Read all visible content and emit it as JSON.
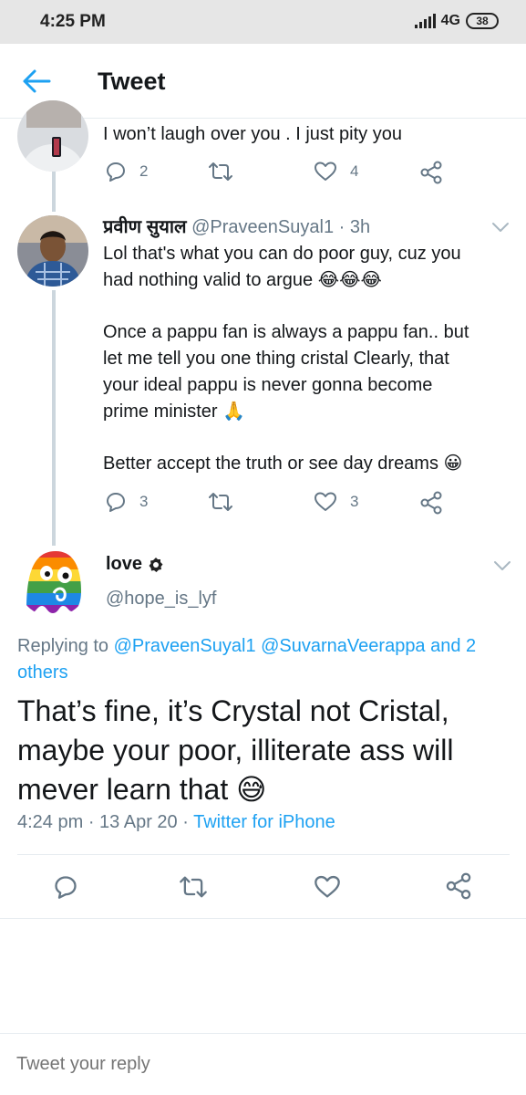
{
  "status_bar": {
    "time": "4:25 PM",
    "network": "4G",
    "battery": "38"
  },
  "header": {
    "title": "Tweet"
  },
  "tweets": [
    {
      "text": "I won’t laugh over you . I just pity you",
      "replies": "2",
      "likes": "4"
    },
    {
      "name": "प्रवीण सुयाल",
      "handle": "@PraveenSuyal1",
      "time": "· 3h",
      "paragraphs": [
        "Lol that's what you can do poor guy, cuz you",
        "had nothing valid to argue 😂😂😂",
        "Once a pappu fan is always a pappu fan.. but",
        "let me tell you one thing cristal Clearly, that",
        "your ideal pappu is never gonna become",
        "prime minister 🙏",
        "Better accept the truth or see day dreams 😀"
      ],
      "replies": "3",
      "likes": "3"
    }
  ],
  "main_tweet": {
    "name": "love",
    "handle": "@hope_is_lyf",
    "replying_prefix": "Replying to",
    "replying_to": "@PraveenSuyal1 @SuvarnaVeerappa and 2 others",
    "text_lines": [
      "That’s fine, it’s Crystal not Cristal,",
      "maybe your poor, illiterate ass will",
      "mever learn that 😅"
    ],
    "time": "4:24 pm · 13 Apr 20 ·",
    "source": "Twitter for iPhone"
  },
  "reply": {
    "placeholder": "Tweet your reply"
  },
  "colors": {
    "accent": "#1da1f2",
    "muted": "#657786",
    "text": "#14171a",
    "divider": "#e6ecf0"
  }
}
